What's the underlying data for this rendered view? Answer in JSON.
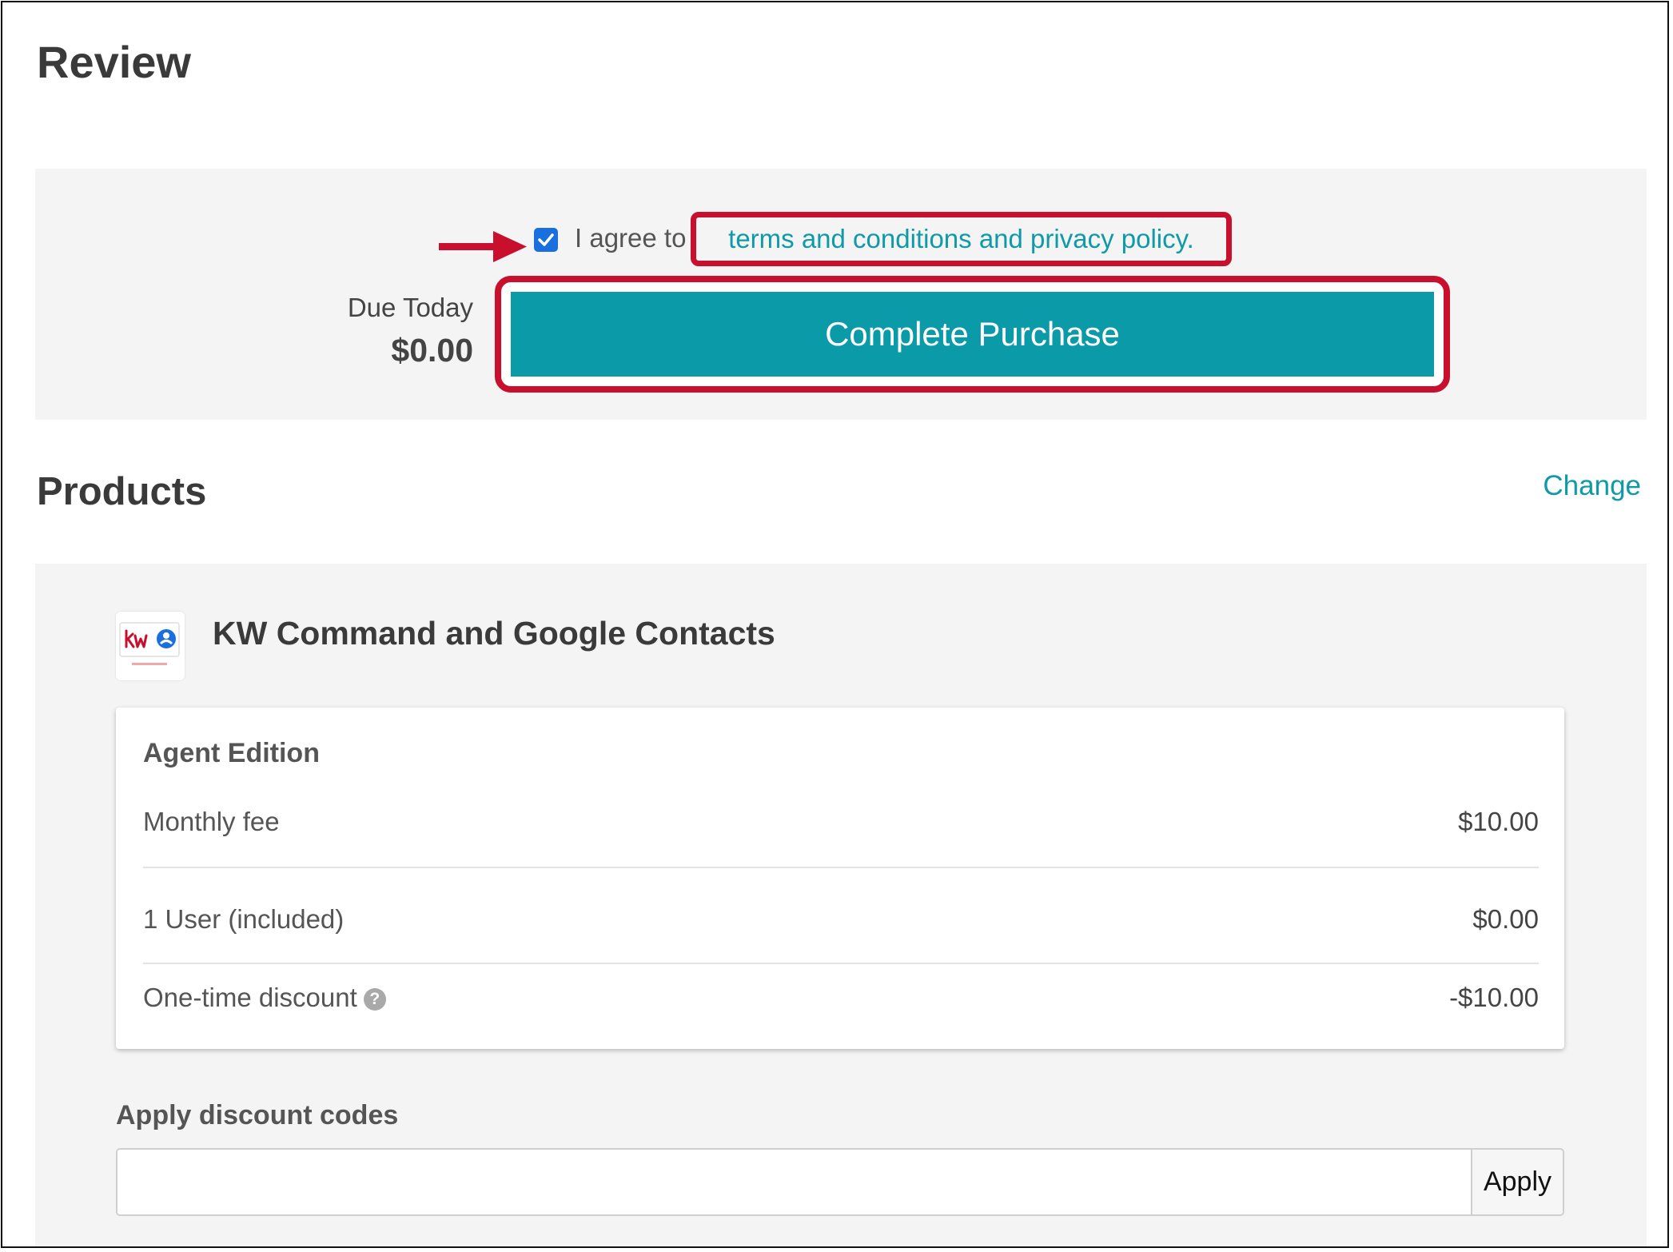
{
  "review": {
    "title": "Review",
    "agree_text": "I agree to the",
    "terms_link": "terms and conditions and privacy policy.",
    "checkbox_checked": true,
    "due_label": "Due Today",
    "due_amount": "$0.00",
    "purchase_label": "Complete Purchase"
  },
  "products": {
    "title": "Products",
    "change_label": "Change",
    "product_name": "KW Command and Google Contacts",
    "logo_icon": "kw-google-contacts-logo-icon",
    "edition": {
      "title": "Agent Edition",
      "lines": [
        {
          "label": "Monthly fee",
          "price": "$10.00"
        },
        {
          "label": "1 User (included)",
          "price": "$0.00"
        },
        {
          "label": "One-time discount",
          "price": "-$10.00"
        }
      ]
    },
    "discount": {
      "label": "Apply discount codes",
      "value": "",
      "apply_label": "Apply"
    }
  },
  "colors": {
    "accent": "#0a9aa8",
    "highlight": "#c8102e",
    "checkbox": "#1a6fe0"
  }
}
